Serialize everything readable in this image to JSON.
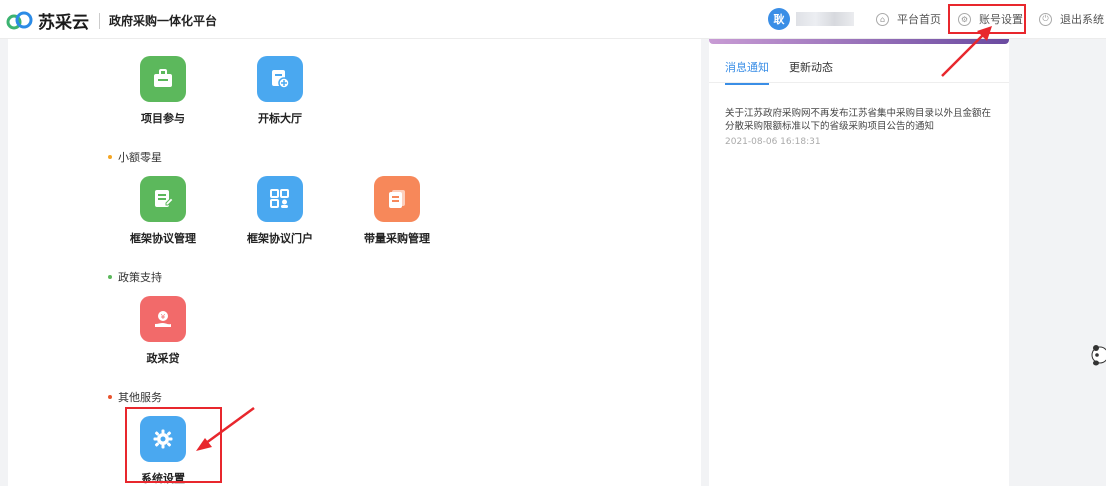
{
  "header": {
    "logo_text": "苏采云",
    "platform_title": "政府采购一体化平台",
    "user": {
      "avatar_text": "耿"
    },
    "nav": {
      "home": "平台首页",
      "account": "账号设置",
      "logout": "退出系统"
    }
  },
  "tiles": {
    "project": "项目参与",
    "bid_hall": "开标大厅",
    "framework_mgmt": "框架协议管理",
    "framework_portal": "框架协议门户",
    "purchase_mgmt": "带量采购管理",
    "loan": "政采贷",
    "system_settings": "系统设置"
  },
  "sections": {
    "small": "小额零星",
    "policy": "政策支持",
    "other": "其他服务"
  },
  "notice_panel": {
    "tabs": [
      "消息通知",
      "更新动态"
    ],
    "items": [
      {
        "title": "关于江苏政府采购网不再发布江苏省集中采购目录以外且金额在分散采购限额标准以下的省级采购项目公告的通知",
        "time": "2021-08-06 16:18:31"
      }
    ]
  },
  "colors": {
    "accent": "#3a8ee6",
    "highlight_red": "#e8272d",
    "green": "#5cb85c",
    "blue": "#4aa8f0",
    "orange": "#f7885a",
    "red_icon": "#f26a6a"
  }
}
